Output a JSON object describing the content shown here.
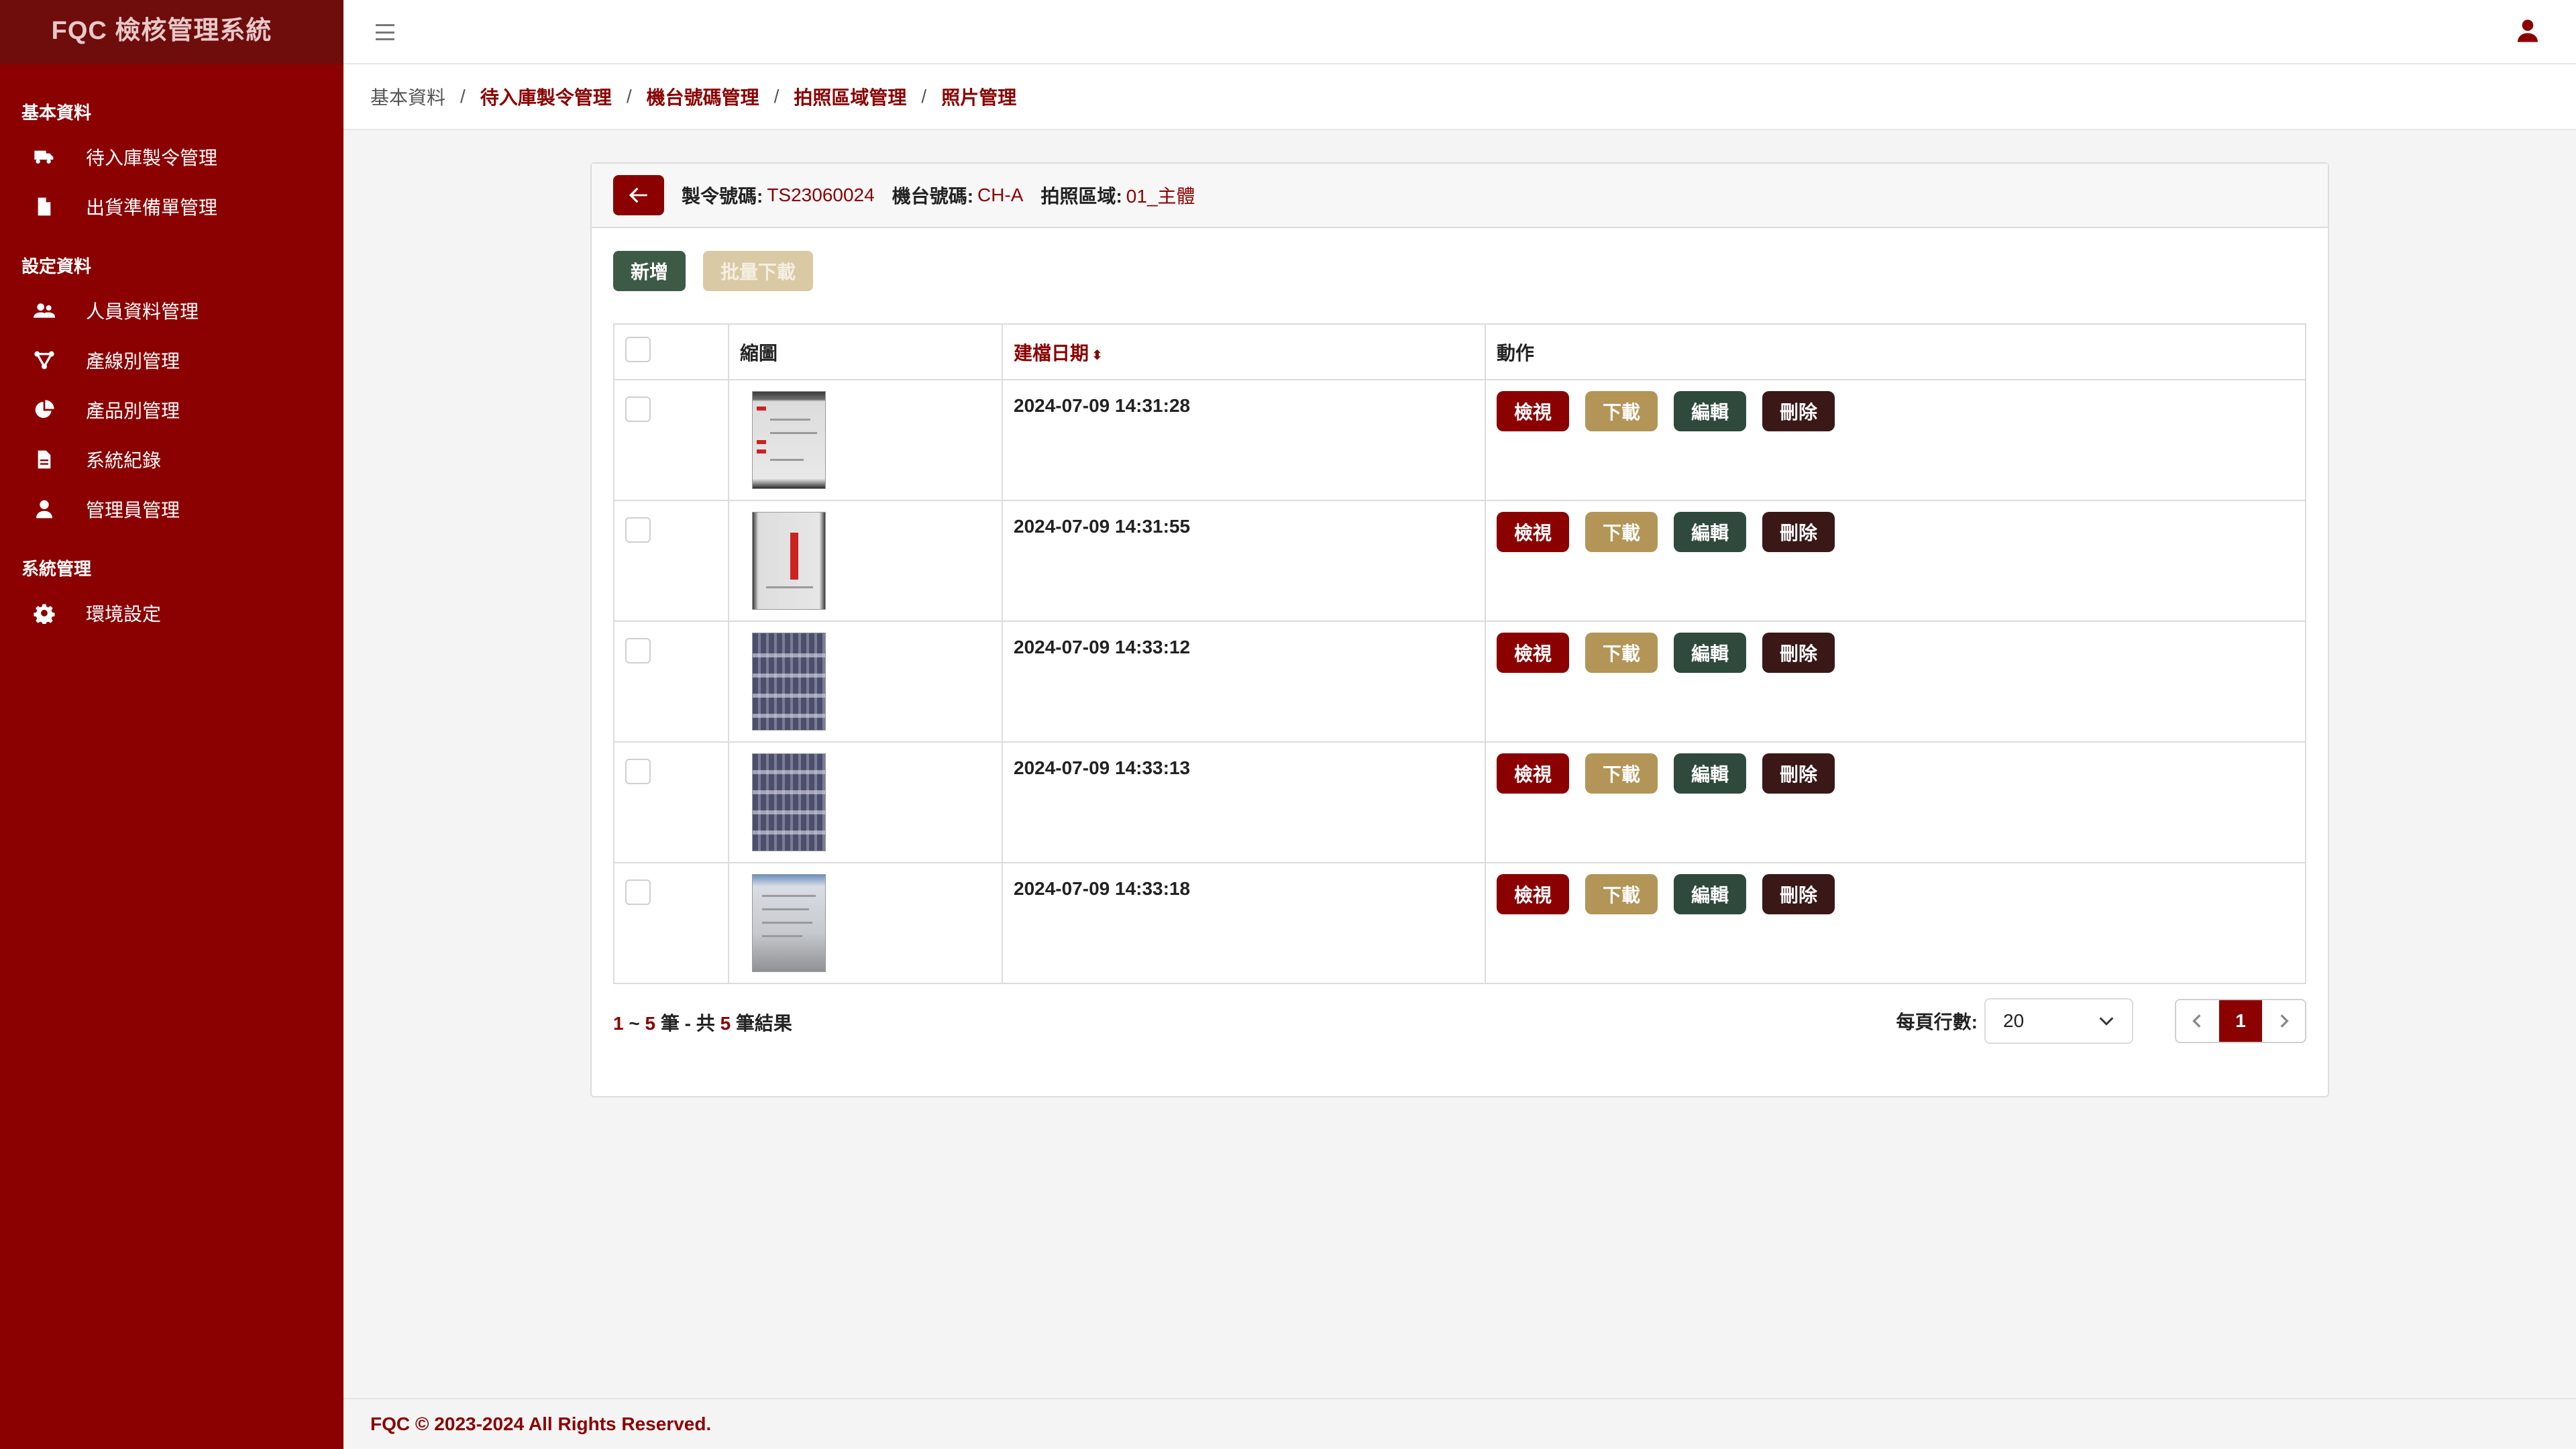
{
  "app": {
    "title": "FQC 檢核管理系統"
  },
  "sidebar": {
    "sections": [
      {
        "title": "基本資料",
        "items": [
          {
            "label": "待入庫製令管理",
            "icon": "truck-icon"
          },
          {
            "label": "出貨準備單管理",
            "icon": "file-icon"
          }
        ]
      },
      {
        "title": "設定資料",
        "items": [
          {
            "label": "人員資料管理",
            "icon": "users-icon"
          },
          {
            "label": "產線別管理",
            "icon": "network-icon"
          },
          {
            "label": "產品別管理",
            "icon": "pie-chart-icon"
          },
          {
            "label": "系統紀錄",
            "icon": "document-icon"
          },
          {
            "label": "管理員管理",
            "icon": "user-icon"
          }
        ]
      },
      {
        "title": "系統管理",
        "items": [
          {
            "label": "環境設定",
            "icon": "gear-icon"
          }
        ]
      }
    ]
  },
  "breadcrumb": {
    "root": "基本資料",
    "links": [
      "待入庫製令管理",
      "機台號碼管理",
      "拍照區域管理",
      "照片管理"
    ],
    "separator": "/"
  },
  "header": {
    "order_label": "製令號碼:",
    "order_value": "TS23060024",
    "machine_label": "機台號碼:",
    "machine_value": "CH-A",
    "area_label": "拍照區域:",
    "area_value": "01_主體"
  },
  "toolbar": {
    "add_label": "新增",
    "batch_download_label": "批量下載"
  },
  "table": {
    "columns": {
      "thumb": "縮圖",
      "created": "建檔日期",
      "actions": "動作"
    },
    "action_labels": {
      "view": "檢視",
      "download": "下載",
      "edit": "編輯",
      "delete": "刪除"
    },
    "rows": [
      {
        "created": "2024-07-09 14:31:28"
      },
      {
        "created": "2024-07-09 14:31:55"
      },
      {
        "created": "2024-07-09 14:33:12"
      },
      {
        "created": "2024-07-09 14:33:13"
      },
      {
        "created": "2024-07-09 14:33:18"
      }
    ]
  },
  "pagination": {
    "from": "1",
    "tilde": "~",
    "to": "5",
    "unit": "筆",
    "dash": "-",
    "total_prefix": "共",
    "total": "5",
    "total_suffix": "筆結果",
    "per_page_label": "每頁行數:",
    "per_page_value": "20",
    "current_page": "1"
  },
  "footer": {
    "text": "FQC © 2023-2024 All Rights Reserved."
  },
  "colors": {
    "primary": "#8b0000",
    "brand_bar": "#6f0c0c",
    "add_button": "#3d5a46",
    "download_button": "#b29557",
    "edit_button": "#2f4a3c",
    "delete_button": "#3a1818"
  }
}
